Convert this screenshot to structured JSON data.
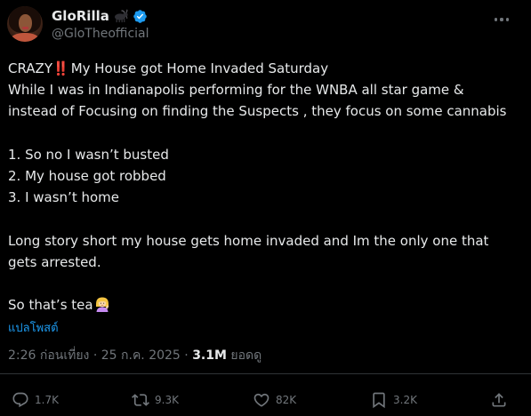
{
  "author": {
    "display_name": "GloRilla",
    "handle": "@GloTheofficial",
    "badge_emoji_icon": "goat-emoji-icon",
    "verified_icon": "verified-badge-icon",
    "verified_color": "#1d9bf0"
  },
  "tweet": {
    "line1_prefix": "CRAZY",
    "line1_bangs": "‼️",
    "line1_rest": "My House got Home Invaded Saturday",
    "line2": "While I was in Indianapolis performing for the WNBA all star game &",
    "line3": "instead of Focusing on finding the Suspects , they focus on some cannabis",
    "list1": "1. So no I wasn’t  busted",
    "list2": "2. My house got robbed",
    "list3": "3. I wasn’t home",
    "para2_line1": "Long story short my house gets home invaded and Im the only one that",
    "para2_line2": "gets arrested.",
    "closing": "So that’s tea",
    "closing_emoji_icon": "woman-tipping-hand-emoji-icon"
  },
  "translate_label": "แปลโพสต์",
  "meta": {
    "timestamp": "2:26 ก่อนเที่ยง · 25 ก.ค. 2025 · ",
    "views_count": "3.1M",
    "views_label": " ยอดดู"
  },
  "actions": {
    "replies": "1.7K",
    "reposts": "9.3K",
    "likes": "82K",
    "bookmarks": "3.2K"
  },
  "colors": {
    "background": "#000000",
    "text": "#e7e9ea",
    "secondary": "#71767b",
    "link": "#1d9bf0",
    "divider": "#2f3336"
  }
}
